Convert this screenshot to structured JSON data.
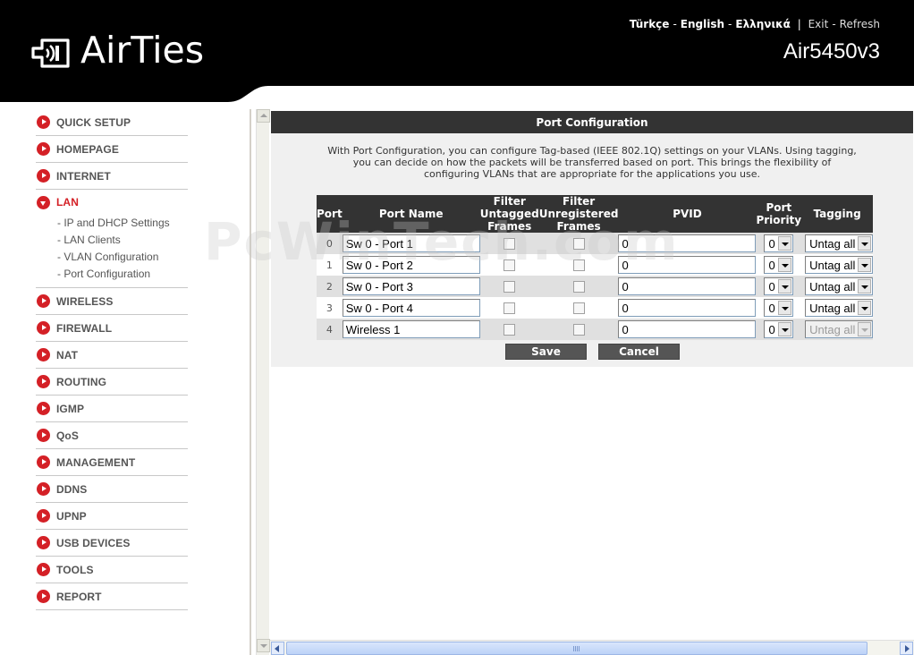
{
  "header": {
    "logo_text": "AirTies",
    "languages": [
      "Türkçe",
      "English",
      "Ελληνικά"
    ],
    "exit_label": "Exit",
    "refresh_label": "Refresh",
    "model": "Air5450v3"
  },
  "sidebar": {
    "items": [
      {
        "label": "QUICK SETUP"
      },
      {
        "label": "HOMEPAGE"
      },
      {
        "label": "INTERNET"
      },
      {
        "label": "LAN",
        "subitems": [
          "IP and DHCP Settings",
          "LAN Clients",
          "VLAN Configuration",
          "Port Configuration"
        ]
      },
      {
        "label": "WIRELESS"
      },
      {
        "label": "FIREWALL"
      },
      {
        "label": "NAT"
      },
      {
        "label": "ROUTING"
      },
      {
        "label": "IGMP"
      },
      {
        "label": "QoS"
      },
      {
        "label": "MANAGEMENT"
      },
      {
        "label": "DDNS"
      },
      {
        "label": "UPNP"
      },
      {
        "label": "USB DEVICES"
      },
      {
        "label": "TOOLS"
      },
      {
        "label": "REPORT"
      }
    ]
  },
  "panel": {
    "title": "Port Configuration",
    "description": "With Port Configuration, you can configure Tag-based (IEEE 802.1Q) settings on your VLANs. Using tagging, you can decide on how the packets will be transferred based on port. This brings the flexibility of configuring VLANs that are appropriate for the applications you use.",
    "columns": {
      "port": "Port",
      "port_name": "Port Name",
      "filter_untagged_1": "Filter",
      "filter_untagged_2": "Untagged",
      "filter_untagged_3": "Frames",
      "filter_unreg_1": "Filter",
      "filter_unreg_2": "Unregistered",
      "filter_unreg_3": "Frames",
      "pvid": "PVID",
      "priority_1": "Port",
      "priority_2": "Priority",
      "tagging": "Tagging"
    },
    "rows": [
      {
        "port": "0",
        "name": "Sw 0 - Port 1",
        "pvid": "0",
        "priority": "0",
        "tagging": "Untag all"
      },
      {
        "port": "1",
        "name": "Sw 0 - Port 2",
        "pvid": "0",
        "priority": "0",
        "tagging": "Untag all"
      },
      {
        "port": "2",
        "name": "Sw 0 - Port 3",
        "pvid": "0",
        "priority": "0",
        "tagging": "Untag all"
      },
      {
        "port": "3",
        "name": "Sw 0 - Port 4",
        "pvid": "0",
        "priority": "0",
        "tagging": "Untag all"
      },
      {
        "port": "4",
        "name": "Wireless 1",
        "pvid": "0",
        "priority": "0",
        "tagging": "Untag all"
      }
    ],
    "save_label": "Save",
    "cancel_label": "Cancel"
  },
  "watermark": "PcWinTech.com",
  "colors": {
    "accent_red": "#d42026",
    "header_bg": "#000000",
    "panel_title_bg": "#333333",
    "button_bg": "#555555"
  }
}
